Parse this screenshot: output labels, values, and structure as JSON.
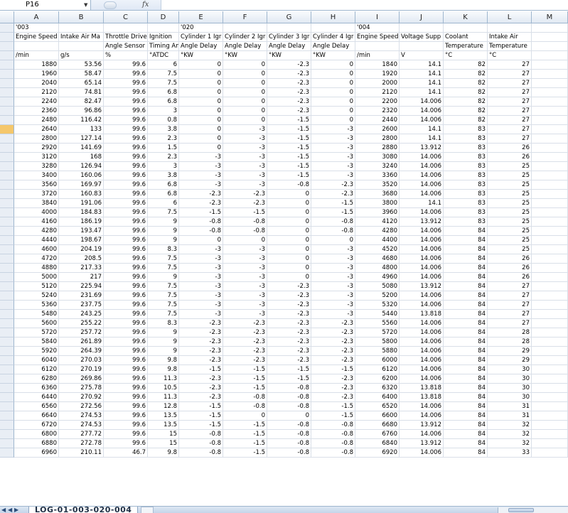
{
  "name_box": "P16",
  "formula_bar": {
    "fx_label": "fx",
    "value": ""
  },
  "columns": [
    "A",
    "B",
    "C",
    "D",
    "E",
    "F",
    "G",
    "H",
    "I",
    "J",
    "K",
    "L",
    "M"
  ],
  "header_rows": [
    [
      "'003",
      "",
      "",
      "",
      "'020",
      "",
      "",
      "",
      "'004",
      "",
      "",
      "",
      ""
    ],
    [
      "Engine Speed",
      "Intake Air Ma",
      "Throttle Drive",
      "Ignition",
      "Cylinder 1 Igr",
      "Cylinder 2 Igr",
      "Cylinder 3 Igr",
      "Cylinder 4 Igr",
      "Engine Speed",
      "Voltage Supp",
      "Coolant",
      "Intake Air",
      ""
    ],
    [
      "",
      "",
      "Angle Sensor",
      "Timing Angle",
      "Angle Delay",
      "Angle Delay",
      "Angle Delay",
      "Angle Delay",
      "",
      "",
      "Temperature",
      "Temperature",
      ""
    ],
    [
      "/min",
      "g/s",
      "%",
      "°ATDC",
      "°KW",
      "°KW",
      "°KW",
      "°KW",
      "/min",
      "V",
      "°C",
      "°C",
      ""
    ]
  ],
  "data_rows": [
    [
      "1880",
      "53.56",
      "99.6",
      "6",
      "0",
      "0",
      "-2.3",
      "0",
      "1840",
      "14.1",
      "82",
      "27"
    ],
    [
      "1960",
      "58.47",
      "99.6",
      "7.5",
      "0",
      "0",
      "-2.3",
      "0",
      "1920",
      "14.1",
      "82",
      "27"
    ],
    [
      "2040",
      "65.14",
      "99.6",
      "7.5",
      "0",
      "0",
      "-2.3",
      "0",
      "2000",
      "14.1",
      "82",
      "27"
    ],
    [
      "2120",
      "74.81",
      "99.6",
      "6.8",
      "0",
      "0",
      "-2.3",
      "0",
      "2120",
      "14.1",
      "82",
      "27"
    ],
    [
      "2240",
      "82.47",
      "99.6",
      "6.8",
      "0",
      "0",
      "-2.3",
      "0",
      "2200",
      "14.006",
      "82",
      "27"
    ],
    [
      "2360",
      "96.86",
      "99.6",
      "3",
      "0",
      "0",
      "-2.3",
      "0",
      "2320",
      "14.006",
      "82",
      "27"
    ],
    [
      "2480",
      "116.42",
      "99.6",
      "0.8",
      "0",
      "0",
      "-1.5",
      "0",
      "2440",
      "14.006",
      "82",
      "27"
    ],
    [
      "2640",
      "133",
      "99.6",
      "3.8",
      "0",
      "-3",
      "-1.5",
      "-3",
      "2600",
      "14.1",
      "83",
      "27"
    ],
    [
      "2800",
      "127.14",
      "99.6",
      "2.3",
      "0",
      "-3",
      "-1.5",
      "-3",
      "2800",
      "14.1",
      "83",
      "27"
    ],
    [
      "2920",
      "141.69",
      "99.6",
      "1.5",
      "0",
      "-3",
      "-1.5",
      "-3",
      "2880",
      "13.912",
      "83",
      "26"
    ],
    [
      "3120",
      "168",
      "99.6",
      "2.3",
      "-3",
      "-3",
      "-1.5",
      "-3",
      "3080",
      "14.006",
      "83",
      "26"
    ],
    [
      "3280",
      "126.94",
      "99.6",
      "3",
      "-3",
      "-3",
      "-1.5",
      "-3",
      "3240",
      "14.006",
      "83",
      "25"
    ],
    [
      "3400",
      "160.06",
      "99.6",
      "3.8",
      "-3",
      "-3",
      "-1.5",
      "-3",
      "3360",
      "14.006",
      "83",
      "25"
    ],
    [
      "3560",
      "169.97",
      "99.6",
      "6.8",
      "-3",
      "-3",
      "-0.8",
      "-2.3",
      "3520",
      "14.006",
      "83",
      "25"
    ],
    [
      "3720",
      "160.83",
      "99.6",
      "6.8",
      "-2.3",
      "-2.3",
      "0",
      "-2.3",
      "3680",
      "14.006",
      "83",
      "25"
    ],
    [
      "3840",
      "191.06",
      "99.6",
      "6",
      "-2.3",
      "-2.3",
      "0",
      "-1.5",
      "3800",
      "14.1",
      "83",
      "25"
    ],
    [
      "4000",
      "184.83",
      "99.6",
      "7.5",
      "-1.5",
      "-1.5",
      "0",
      "-1.5",
      "3960",
      "14.006",
      "83",
      "25"
    ],
    [
      "4160",
      "186.19",
      "99.6",
      "9",
      "-0.8",
      "-0.8",
      "0",
      "-0.8",
      "4120",
      "13.912",
      "83",
      "25"
    ],
    [
      "4280",
      "193.47",
      "99.6",
      "9",
      "-0.8",
      "-0.8",
      "0",
      "-0.8",
      "4280",
      "14.006",
      "84",
      "25"
    ],
    [
      "4440",
      "198.67",
      "99.6",
      "9",
      "0",
      "0",
      "0",
      "0",
      "4400",
      "14.006",
      "84",
      "25"
    ],
    [
      "4600",
      "204.19",
      "99.6",
      "8.3",
      "-3",
      "-3",
      "0",
      "-3",
      "4520",
      "14.006",
      "84",
      "25"
    ],
    [
      "4720",
      "208.5",
      "99.6",
      "7.5",
      "-3",
      "-3",
      "0",
      "-3",
      "4680",
      "14.006",
      "84",
      "26"
    ],
    [
      "4880",
      "217.33",
      "99.6",
      "7.5",
      "-3",
      "-3",
      "0",
      "-3",
      "4800",
      "14.006",
      "84",
      "26"
    ],
    [
      "5000",
      "217",
      "99.6",
      "9",
      "-3",
      "-3",
      "0",
      "-3",
      "4960",
      "14.006",
      "84",
      "26"
    ],
    [
      "5120",
      "225.94",
      "99.6",
      "7.5",
      "-3",
      "-3",
      "-2.3",
      "-3",
      "5080",
      "13.912",
      "84",
      "27"
    ],
    [
      "5240",
      "231.69",
      "99.6",
      "7.5",
      "-3",
      "-3",
      "-2.3",
      "-3",
      "5200",
      "14.006",
      "84",
      "27"
    ],
    [
      "5360",
      "237.75",
      "99.6",
      "7.5",
      "-3",
      "-3",
      "-2.3",
      "-3",
      "5320",
      "14.006",
      "84",
      "27"
    ],
    [
      "5480",
      "243.25",
      "99.6",
      "7.5",
      "-3",
      "-3",
      "-2.3",
      "-3",
      "5440",
      "13.818",
      "84",
      "27"
    ],
    [
      "5600",
      "255.22",
      "99.6",
      "8.3",
      "-2.3",
      "-2.3",
      "-2.3",
      "-2.3",
      "5560",
      "14.006",
      "84",
      "27"
    ],
    [
      "5720",
      "257.72",
      "99.6",
      "9",
      "-2.3",
      "-2.3",
      "-2.3",
      "-2.3",
      "5720",
      "14.006",
      "84",
      "28"
    ],
    [
      "5840",
      "261.89",
      "99.6",
      "9",
      "-2.3",
      "-2.3",
      "-2.3",
      "-2.3",
      "5800",
      "14.006",
      "84",
      "28"
    ],
    [
      "5920",
      "264.39",
      "99.6",
      "9",
      "-2.3",
      "-2.3",
      "-2.3",
      "-2.3",
      "5880",
      "14.006",
      "84",
      "29"
    ],
    [
      "6040",
      "270.03",
      "99.6",
      "9.8",
      "-2.3",
      "-2.3",
      "-2.3",
      "-2.3",
      "6000",
      "14.006",
      "84",
      "29"
    ],
    [
      "6120",
      "270.19",
      "99.6",
      "9.8",
      "-1.5",
      "-1.5",
      "-1.5",
      "-1.5",
      "6120",
      "14.006",
      "84",
      "30"
    ],
    [
      "6280",
      "269.86",
      "99.6",
      "11.3",
      "-2.3",
      "-1.5",
      "-1.5",
      "-2.3",
      "6200",
      "14.006",
      "84",
      "30"
    ],
    [
      "6360",
      "275.78",
      "99.6",
      "10.5",
      "-2.3",
      "-1.5",
      "-0.8",
      "-2.3",
      "6320",
      "13.818",
      "84",
      "30"
    ],
    [
      "6440",
      "270.92",
      "99.6",
      "11.3",
      "-2.3",
      "-0.8",
      "-0.8",
      "-2.3",
      "6400",
      "13.818",
      "84",
      "30"
    ],
    [
      "6560",
      "272.56",
      "99.6",
      "12.8",
      "-1.5",
      "-0.8",
      "-0.8",
      "-1.5",
      "6520",
      "14.006",
      "84",
      "31"
    ],
    [
      "6640",
      "274.53",
      "99.6",
      "13.5",
      "-1.5",
      "0",
      "0",
      "-1.5",
      "6600",
      "14.006",
      "84",
      "31"
    ],
    [
      "6720",
      "274.53",
      "99.6",
      "13.5",
      "-1.5",
      "-1.5",
      "-0.8",
      "-0.8",
      "6680",
      "13.912",
      "84",
      "32"
    ],
    [
      "6800",
      "277.72",
      "99.6",
      "15",
      "-0.8",
      "-1.5",
      "-0.8",
      "-0.8",
      "6760",
      "14.006",
      "84",
      "32"
    ],
    [
      "6880",
      "272.78",
      "99.6",
      "15",
      "-0.8",
      "-1.5",
      "-0.8",
      "-0.8",
      "6840",
      "13.912",
      "84",
      "32"
    ],
    [
      "6960",
      "210.11",
      "46.7",
      "9.8",
      "-0.8",
      "-1.5",
      "-0.8",
      "-0.8",
      "6920",
      "14.006",
      "84",
      "33"
    ]
  ],
  "sheet_tab": "LOG-01-003-020-004",
  "colors": {
    "header_bg": "#e1e9f3",
    "grid_line": "#d9dfe8",
    "active_row_marker": "#f5c76b"
  }
}
